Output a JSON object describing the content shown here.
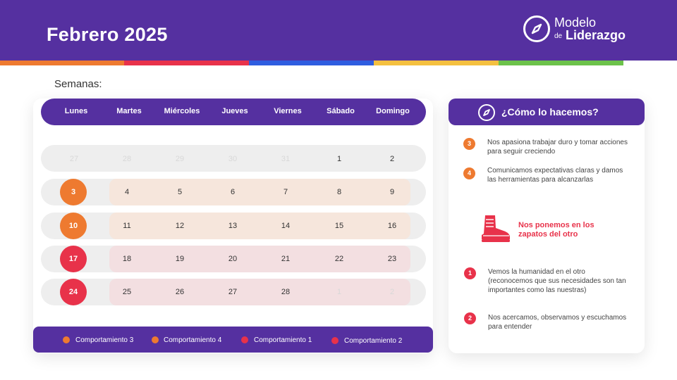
{
  "header": {
    "title": "Febrero 2025"
  },
  "logo": {
    "line1": "Modelo",
    "small": "de",
    "line2": "Liderazgo"
  },
  "colors": {
    "purple": "#5530a0",
    "orange": "#ee7a30",
    "red": "#e8324a",
    "blue": "#2f5de0",
    "yellow": "#f4c040",
    "green": "#6cc24a"
  },
  "calendar": {
    "label": "Semanas:",
    "days": [
      "Lunes",
      "Martes",
      "Miércoles",
      "Jueves",
      "Viernes",
      "Sábado",
      "Domingo"
    ],
    "weeks": [
      [
        "27",
        "28",
        "29",
        "30",
        "31",
        "1",
        "2"
      ],
      [
        "3",
        "4",
        "5",
        "6",
        "7",
        "8",
        "9"
      ],
      [
        "10",
        "11",
        "12",
        "13",
        "14",
        "15",
        "16"
      ],
      [
        "17",
        "18",
        "19",
        "20",
        "21",
        "22",
        "23"
      ],
      [
        "24",
        "25",
        "26",
        "27",
        "28",
        "1",
        "2"
      ]
    ]
  },
  "legend": [
    {
      "label": "Comportamiento 3",
      "color": "#ee7a30"
    },
    {
      "label": "Comportamiento 4",
      "color": "#ee7a30"
    },
    {
      "label": "Comportamiento 1",
      "color": "#e8324a"
    },
    {
      "label": "Comportamiento 2",
      "color": "#e8324a"
    }
  ],
  "side": {
    "title": "¿Cómo lo hacemos?",
    "items": [
      {
        "num": "3",
        "text": "Nos apasiona trabajar duro y tomar acciones para seguir creciendo"
      },
      {
        "num": "4",
        "text": "Comunicamos expectativas claras y damos las herramientas para alcanzarlas"
      },
      {
        "num": "1",
        "text": "Vemos la humanidad en el otro (reconocemos que sus necesidades son tan importantes como las nuestras)"
      },
      {
        "num": "2",
        "text": "Nos acercamos, observamos y escuchamos para entender"
      }
    ],
    "highlight": "Nos ponemos en los zapatos del otro"
  }
}
